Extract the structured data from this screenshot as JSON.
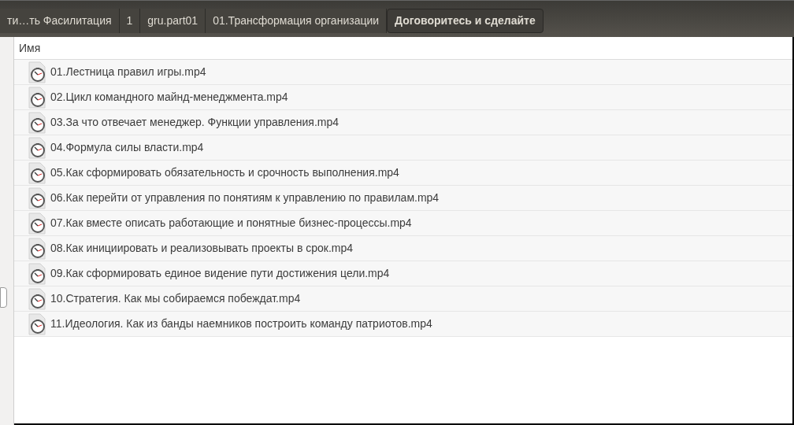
{
  "breadcrumbs": [
    {
      "label": "ти…ть Фасилитация",
      "selected": false
    },
    {
      "label": "1",
      "selected": false
    },
    {
      "label": "gru.part01",
      "selected": false
    },
    {
      "label": "01.Трансформация организации",
      "selected": false
    },
    {
      "label": "Договоритесь и сделайте",
      "selected": true
    }
  ],
  "table": {
    "columns": [
      "Имя"
    ],
    "rows": [
      {
        "name": "01.Лестница правил игры.mp4"
      },
      {
        "name": "02.Цикл командного майнд-менеджмента.mp4"
      },
      {
        "name": "03.За что отвечает менеджер. Функции управления.mp4"
      },
      {
        "name": "04.Формула силы власти.mp4"
      },
      {
        "name": "05.Как сформировать обязательность и срочность выполнения.mp4"
      },
      {
        "name": "06.Как перейти от управления по понятиям к управлению по правилам.mp4"
      },
      {
        "name": "07.Как вместе описать работающие и понятные бизнес-процессы.mp4"
      },
      {
        "name": "08.Как инициировать и реализовывать проекты в срок.mp4"
      },
      {
        "name": "09.Как сформировать единое видение пути достижения цели.mp4"
      },
      {
        "name": "10.Стратегия. Как мы собираемся побеждат.mp4"
      },
      {
        "name": "11.Идеология. Как из банды наемников построить команду патриотов.mp4"
      }
    ]
  }
}
